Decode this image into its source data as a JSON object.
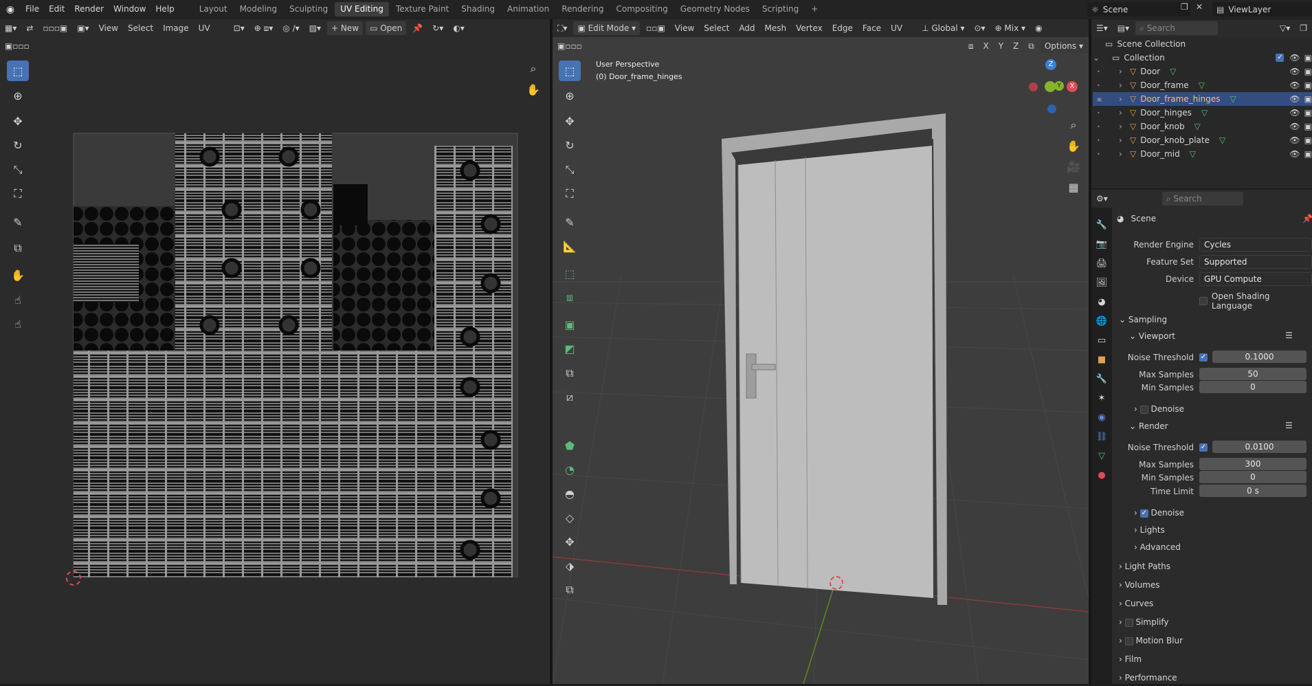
{
  "menu": [
    "File",
    "Edit",
    "Render",
    "Window",
    "Help"
  ],
  "workspaces": [
    "Layout",
    "Modeling",
    "Sculpting",
    "UV Editing",
    "Texture Paint",
    "Shading",
    "Animation",
    "Rendering",
    "Compositing",
    "Geometry Nodes",
    "Scripting"
  ],
  "active_workspace": "UV Editing",
  "add_workspace": "+",
  "scene_field": "Scene",
  "viewlayer_field": "ViewLayer",
  "uv_editor": {
    "menus": [
      "View",
      "Select",
      "Image",
      "UV"
    ],
    "new_label": "New",
    "open_label": "Open"
  },
  "viewport": {
    "mode": "Edit Mode",
    "menus": [
      "View",
      "Select",
      "Add",
      "Mesh",
      "Vertex",
      "Edge",
      "Face",
      "UV"
    ],
    "transform": "Global",
    "shading_mix": "Mix",
    "options": "Options",
    "axes": [
      "X",
      "Y",
      "Z"
    ],
    "overlay_line1": "User Perspective",
    "overlay_line2": "(0) Door_frame_hinges",
    "gizmo": {
      "x": "X",
      "y": "Y",
      "z": "Z"
    }
  },
  "outliner": {
    "search_placeholder": "Search",
    "root": "Scene Collection",
    "collection": "Collection",
    "objects": [
      "Door",
      "Door_frame",
      "Door_frame_hinges",
      "Door_hinges",
      "Door_knob",
      "Door_knob_plate",
      "Door_mid"
    ],
    "selected": "Door_frame_hinges"
  },
  "properties": {
    "search_placeholder": "Search",
    "context": "Scene",
    "render_engine_label": "Render Engine",
    "render_engine": "Cycles",
    "feature_set_label": "Feature Set",
    "feature_set": "Supported",
    "device_label": "Device",
    "device": "GPU Compute",
    "osl_label": "Open Shading Language",
    "sampling": "Sampling",
    "viewport": "Viewport",
    "noise_threshold_label": "Noise Threshold",
    "vp_noise": "0.1000",
    "max_samples_label": "Max Samples",
    "vp_max": "50",
    "min_samples_label": "Min Samples",
    "vp_min": "0",
    "denoise_label": "Denoise",
    "render": "Render",
    "r_noise": "0.0100",
    "r_max": "300",
    "r_min": "0",
    "time_limit_label": "Time Limit",
    "r_time": "0 s",
    "lights": "Lights",
    "advanced": "Advanced",
    "panels": [
      "Light Paths",
      "Volumes",
      "Curves",
      "Simplify",
      "Motion Blur",
      "Film",
      "Performance"
    ]
  },
  "colors": {
    "accent": "#4772b3",
    "selected_row": "#334d80",
    "object_orange": "#e5a050",
    "mesh_green": "#5dbb7a",
    "x_axis": "#e24a55",
    "y_axis": "#86b32c",
    "z_axis": "#3b7fd9"
  }
}
